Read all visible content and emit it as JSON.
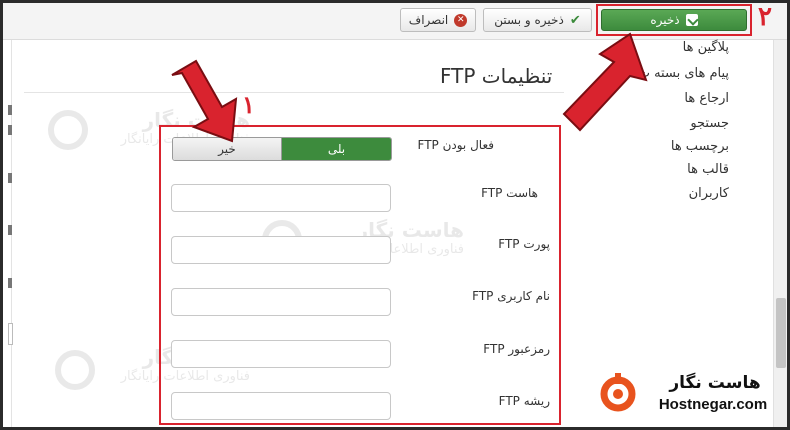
{
  "toolbar": {
    "save_label": "ذخیره",
    "save_close_label": "ذخیره و بستن",
    "cancel_label": "انصراف"
  },
  "annotations": {
    "marker_form": "۱",
    "marker_save": "۲"
  },
  "sidebar": {
    "items": [
      {
        "label": "پلاگین ها"
      },
      {
        "label": "پیام های بسته ت"
      },
      {
        "label": "ارجاع ها"
      },
      {
        "label": "جستجو"
      },
      {
        "label": "برچسب ها"
      },
      {
        "label": "قالب ها"
      },
      {
        "label": "کاربران"
      }
    ]
  },
  "page": {
    "title": "تنظیمات FTP"
  },
  "form": {
    "ftp_enable": {
      "label": "فعال بودن FTP",
      "options": [
        "خیر",
        "بلی"
      ],
      "selected": "بلی"
    },
    "fields": [
      {
        "label": "هاست FTP",
        "value": ""
      },
      {
        "label": "پورت FTP",
        "value": ""
      },
      {
        "label": "نام کاربری FTP",
        "value": ""
      },
      {
        "label": "رمزعبور FTP",
        "value": ""
      },
      {
        "label": "ریشه FTP",
        "value": ""
      }
    ]
  },
  "watermark": {
    "title": "هاست نگار",
    "subtitle": "فناوری اطلاعات رایانگار"
  },
  "brand": {
    "name_fa": "هاست نگار",
    "name_en": "Hostnegar.com",
    "color": "#e8531e"
  },
  "colors": {
    "save_green": "#3d8b3d",
    "highlight_red": "#d9232e"
  }
}
